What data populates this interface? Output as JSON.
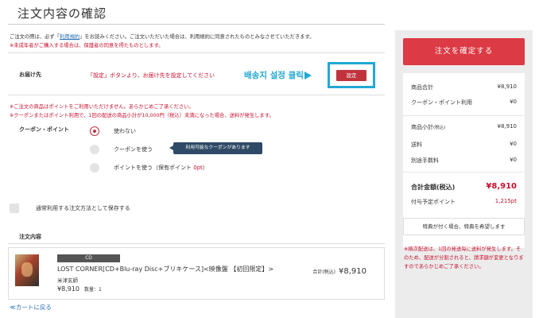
{
  "page": {
    "title": "注文内容の確認"
  },
  "notices": {
    "terms_pre": "ご注文の際は、必ず「",
    "terms_link": "利用規約",
    "terms_post": "」をお読みください。ご注文いただいた場合は、利用規約に同意されたものとみなさせていただきます。",
    "minor": "※未成年者がご購入する場合は、保護者の同意を得たものとします。",
    "points_unusable": "※ご注文の商品はポイントをご利用いただけません。あらかじめご了承ください。",
    "shipping_fee": "※クーポンまたはポイント利用で、1回の配送の商品小計が10,000円（税込）未満になった場合、送料が発生します。"
  },
  "shipping": {
    "label": "お届け先",
    "message": "「設定」ボタンより、お届け先を設定してください",
    "annotation": "배송지 설정 클릭",
    "set_button": "設定"
  },
  "coupon": {
    "label": "クーポン・ポイント",
    "options": [
      {
        "label": "使わない",
        "selected": true
      },
      {
        "label": "クーポンを使う",
        "selected": false
      },
      {
        "label": "ポイントを使う（保有ポイント ",
        "points": "0pt",
        "suffix": "）",
        "selected": false
      }
    ],
    "tooltip": "利用可能なクーポンがあります"
  },
  "save_option": {
    "label": "通常利用する注文方法として保存する",
    "checked": false
  },
  "items": {
    "title": "注文内容",
    "list": [
      {
        "format": "CD",
        "name": "LOST CORNER[CD+Blu-ray Disc+ブリキケース]<映像盤 【初回限定】>",
        "artist": "米津玄師",
        "price": "¥8,910",
        "qty_label": "数量：1",
        "subtotal_label": "合計(税込)",
        "subtotal": "¥8,910"
      }
    ]
  },
  "back_link": "≪カートに戻る",
  "sidebar": {
    "confirm_button": "注文を確定する",
    "rows": {
      "goods_total": {
        "label": "商品合計",
        "value": "¥8,910"
      },
      "coupon_point": {
        "label": "クーポン・ポイント利用",
        "value": "¥0"
      },
      "subtotal": {
        "label": "商品小計",
        "label_small": "(税込)",
        "value": "¥8,910"
      },
      "shipping": {
        "label": "送料",
        "value": "¥0"
      },
      "handling": {
        "label": "別途手数料",
        "value": "¥0"
      },
      "total": {
        "label": "合計金額(税込)",
        "value": "¥8,910"
      },
      "points": {
        "label": "付与予定ポイント",
        "value": "1,215pt"
      }
    },
    "benefit_button": "特典が付く場合、特典を希望します",
    "note": "※順次配送は、1回の発送毎に送料が発生します。そのため、配送が分割されると、請求額が変更となりますのであらかじめご了承ください。"
  },
  "colors": {
    "accent_red": "#c8102e",
    "button_red": "#dc3a44",
    "annotation_blue": "#22a8d4",
    "tooltip_navy": "#2f4a66"
  }
}
